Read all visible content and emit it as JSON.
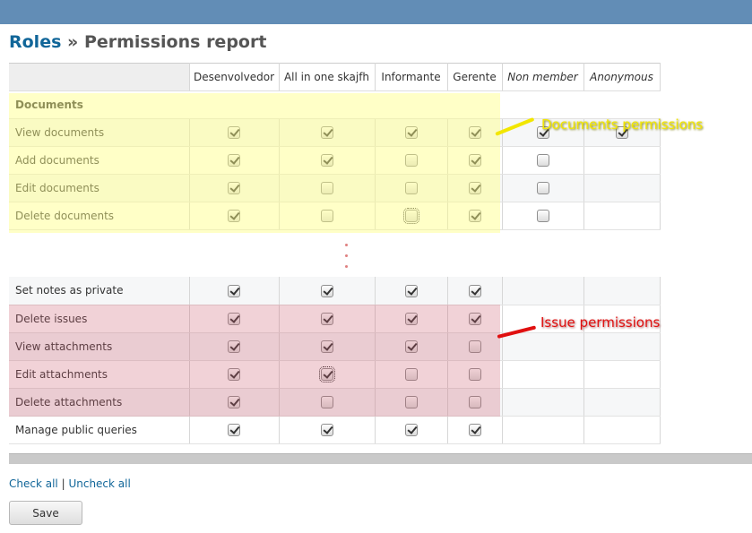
{
  "breadcrumb": {
    "root": "Roles",
    "separator": "»",
    "current": "Permissions report"
  },
  "columns": [
    "Desenvolvedor",
    "All in one skajfh",
    "Informante",
    "Gerente",
    "Non member",
    "Anonymous"
  ],
  "top_table": {
    "group_title": "Documents",
    "rows": [
      {
        "label": "View documents",
        "checks": [
          true,
          true,
          true,
          true,
          true,
          true
        ]
      },
      {
        "label": "Add documents",
        "checks": [
          true,
          true,
          false,
          true,
          false,
          null
        ]
      },
      {
        "label": "Edit documents",
        "checks": [
          true,
          false,
          false,
          true,
          false,
          null
        ]
      },
      {
        "label": "Delete documents",
        "checks": [
          true,
          false,
          false,
          true,
          false,
          null
        ]
      }
    ]
  },
  "bottom_table": {
    "rows": [
      {
        "label": "Set notes as private",
        "checks": [
          true,
          true,
          true,
          true,
          null,
          null
        ]
      },
      {
        "label": "Delete issues",
        "checks": [
          true,
          true,
          true,
          true,
          null,
          null
        ]
      },
      {
        "label": "View attachments",
        "checks": [
          true,
          true,
          true,
          false,
          null,
          null
        ]
      },
      {
        "label": "Edit attachments",
        "checks": [
          true,
          true,
          false,
          false,
          null,
          null
        ]
      },
      {
        "label": "Delete attachments",
        "checks": [
          true,
          false,
          false,
          false,
          null,
          null
        ]
      },
      {
        "label": "Manage public queries",
        "checks": [
          true,
          true,
          true,
          true,
          null,
          null
        ]
      }
    ]
  },
  "annotations": {
    "documents": "Documents permissions",
    "issues": "Issue permissions",
    "documents_color": "#f2e600",
    "issues_color": "#e01010"
  },
  "links": {
    "check_all": "Check all",
    "divider": "|",
    "uncheck_all": "Uncheck all"
  },
  "save_label": "Save",
  "colors": {
    "topbar": "#628db6",
    "link": "#116699"
  }
}
